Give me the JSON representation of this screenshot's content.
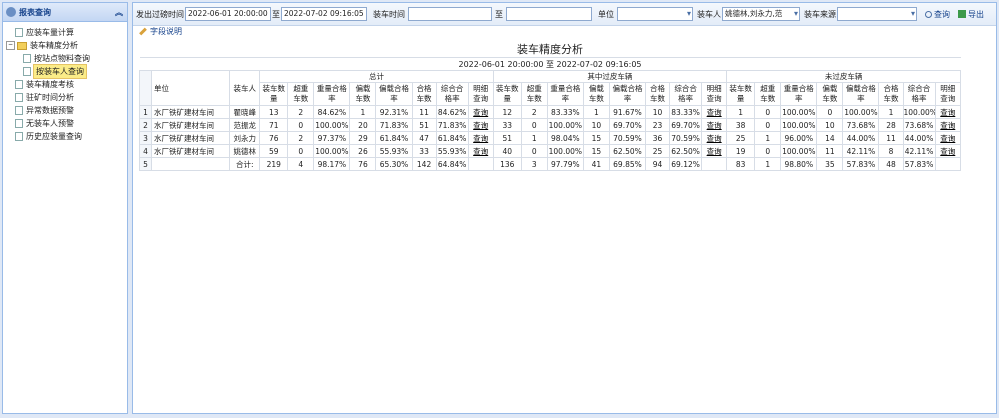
{
  "sidebar": {
    "title": "报表查询",
    "items": [
      {
        "label": "应装车量计算"
      },
      {
        "label": "装车精度分析"
      },
      {
        "label": "按站点物料查询"
      },
      {
        "label": "按装车人查询"
      },
      {
        "label": "装车精度考核"
      },
      {
        "label": "驻矿时间分析"
      },
      {
        "label": "异常数据预警"
      },
      {
        "label": "无装车人预警"
      },
      {
        "label": "历史应装量查询"
      }
    ]
  },
  "toolbar": {
    "dispatch_time_label": "发出过磅时间",
    "dispatch_start": "2022-06-01 20:00:00",
    "to1": "至",
    "dispatch_end": "2022-07-02 09:16:05",
    "load_time_label": "装车时间",
    "load_start": "",
    "to2": "至",
    "load_end": "",
    "unit_label": "单位",
    "unit_value": "",
    "loader_label": "装车人",
    "loader_value": "姚德林,刘永力,范",
    "source_label": "装车来源",
    "source_value": "",
    "query_label": "查询",
    "export_label": "导出",
    "field_desc_label": "字段说明"
  },
  "report": {
    "title": "装车精度分析",
    "date_range": "2022-06-01 20:00:00 至 2022-07-02 09:16:05",
    "col_unit": "单位",
    "col_loader": "装车人",
    "group_total": "总计",
    "group_passed": "其中过皮车辆",
    "group_unpassed": "未过皮车辆",
    "sub_headers": [
      "装车数量",
      "超重车数",
      "重量合格率",
      "偏载车数",
      "偏载合格率",
      "合格车数",
      "综合合格率",
      "明细查询"
    ],
    "rows": [
      {
        "no": "1",
        "unit": "水厂铁矿建材车间",
        "loader": "瞿晓峰",
        "t": [
          "13",
          "2",
          "84.62%",
          "1",
          "92.31%",
          "11",
          "84.62%",
          "查询"
        ],
        "p": [
          "12",
          "2",
          "83.33%",
          "1",
          "91.67%",
          "10",
          "83.33%",
          "查询"
        ],
        "u": [
          "1",
          "0",
          "100.00%",
          "0",
          "100.00%",
          "1",
          "100.00%",
          "查询"
        ]
      },
      {
        "no": "2",
        "unit": "水厂铁矿建材车间",
        "loader": "范振龙",
        "t": [
          "71",
          "0",
          "100.00%",
          "20",
          "71.83%",
          "51",
          "71.83%",
          "查询"
        ],
        "p": [
          "33",
          "0",
          "100.00%",
          "10",
          "69.70%",
          "23",
          "69.70%",
          "查询"
        ],
        "u": [
          "38",
          "0",
          "100.00%",
          "10",
          "73.68%",
          "28",
          "73.68%",
          "查询"
        ]
      },
      {
        "no": "3",
        "unit": "水厂铁矿建材车间",
        "loader": "刘永力",
        "t": [
          "76",
          "2",
          "97.37%",
          "29",
          "61.84%",
          "47",
          "61.84%",
          "查询"
        ],
        "p": [
          "51",
          "1",
          "98.04%",
          "15",
          "70.59%",
          "36",
          "70.59%",
          "查询"
        ],
        "u": [
          "25",
          "1",
          "96.00%",
          "14",
          "44.00%",
          "11",
          "44.00%",
          "查询"
        ]
      },
      {
        "no": "4",
        "unit": "水厂铁矿建材车间",
        "loader": "姚德林",
        "t": [
          "59",
          "0",
          "100.00%",
          "26",
          "55.93%",
          "33",
          "55.93%",
          "查询"
        ],
        "p": [
          "40",
          "0",
          "100.00%",
          "15",
          "62.50%",
          "25",
          "62.50%",
          "查询"
        ],
        "u": [
          "19",
          "0",
          "100.00%",
          "11",
          "42.11%",
          "8",
          "42.11%",
          "查询"
        ]
      },
      {
        "no": "5",
        "unit": "",
        "loader": "合计:",
        "t": [
          "219",
          "4",
          "98.17%",
          "76",
          "65.30%",
          "142",
          "64.84%",
          ""
        ],
        "p": [
          "136",
          "3",
          "97.79%",
          "41",
          "69.85%",
          "94",
          "69.12%",
          ""
        ],
        "u": [
          "83",
          "1",
          "98.80%",
          "35",
          "57.83%",
          "48",
          "57.83%",
          ""
        ]
      }
    ]
  }
}
